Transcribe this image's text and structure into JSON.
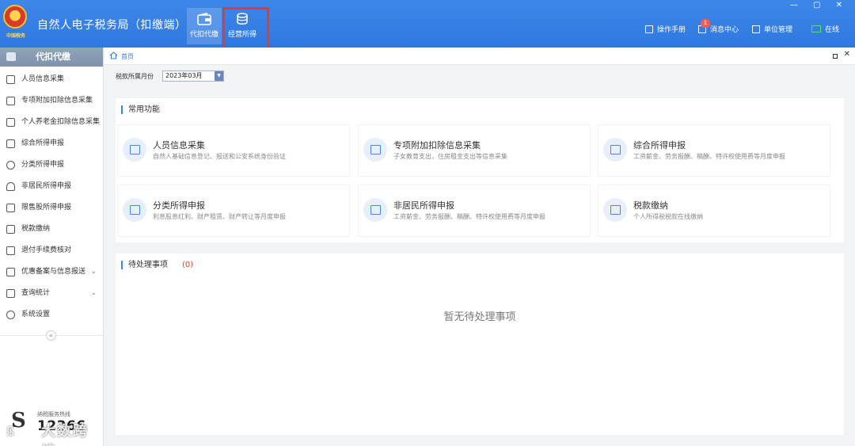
{
  "app": {
    "title": "自然人电子税务局（扣缴端）",
    "emblem_text": "中国税务",
    "window_controls": "—  ▢  ✕"
  },
  "topnav": [
    {
      "label": "代扣代缴",
      "icon": "wallet-icon",
      "active": true
    },
    {
      "label": "经营所得",
      "icon": "coins-icon",
      "active": false
    }
  ],
  "toolbar": {
    "manual": "操作手册",
    "messages": "消息中心",
    "message_count": "1",
    "unit": "单位管理",
    "status": "在线"
  },
  "sidebar": {
    "header": "代扣代缴",
    "items": [
      {
        "label": "人员信息采集",
        "icon": "person-icon"
      },
      {
        "label": "专项附加扣除信息采集",
        "icon": "list-icon"
      },
      {
        "label": "个人养老金扣除信息采集",
        "icon": "pension-icon"
      },
      {
        "label": "综合所得申报",
        "icon": "layers-icon"
      },
      {
        "label": "分类所得申报",
        "icon": "pie-icon"
      },
      {
        "label": "非居民所得申报",
        "icon": "user-icon"
      },
      {
        "label": "限售股所得申报",
        "icon": "bar-chart-icon"
      },
      {
        "label": "税款缴纳",
        "icon": "folder-icon"
      },
      {
        "label": "退付手续费核对",
        "icon": "document-icon"
      },
      {
        "label": "优惠备案与信息报送",
        "icon": "copy-icon",
        "expandable": true
      },
      {
        "label": "查询统计",
        "icon": "search-list-icon",
        "expandable": true
      },
      {
        "label": "系统设置",
        "icon": "gear-icon"
      }
    ],
    "collapse_glyph": "«",
    "hotline_label": "纳税服务热线",
    "hotline_number": "12366",
    "hotline_logo": "S",
    "watermark": "大数跨境",
    "watermark_icon": "ß"
  },
  "breadcrumb": {
    "home": "首页",
    "close_glyph": "✕"
  },
  "period": {
    "label": "税款所属月份",
    "value": "2023年03月",
    "drop_glyph": "▼"
  },
  "common_functions": {
    "title": "常用功能",
    "cards": [
      {
        "title": "人员信息采集",
        "desc": "自然人基础信息登记、报送和公安系统身份验证",
        "icon": "id-card-icon"
      },
      {
        "title": "专项附加扣除信息采集",
        "desc": "子女教育支出，住房租金支出等信息采集",
        "icon": "form-icon"
      },
      {
        "title": "综合所得申报",
        "desc": "工资薪金、劳务报酬、稿酬、特许权使用费等月度申报",
        "icon": "report-icon"
      },
      {
        "title": "分类所得申报",
        "desc": "利息股息红利、财产租赁、财产转让等月度申报",
        "icon": "edit-icon"
      },
      {
        "title": "非居民所得申报",
        "desc": "工资薪金、劳务报酬、稿酬、特许权使用费等月度申报",
        "icon": "edit-icon"
      },
      {
        "title": "税款缴纳",
        "desc": "个人所得税税款在线缴纳",
        "icon": "payment-icon"
      }
    ]
  },
  "pending": {
    "title": "待处理事项",
    "count": "(0)",
    "empty_text": "暂无待处理事项"
  },
  "colors": {
    "topbar": "#3d87ea",
    "accent": "#3878e0",
    "highlight": "#e63a2a",
    "pending_count": "#e53b2e"
  }
}
